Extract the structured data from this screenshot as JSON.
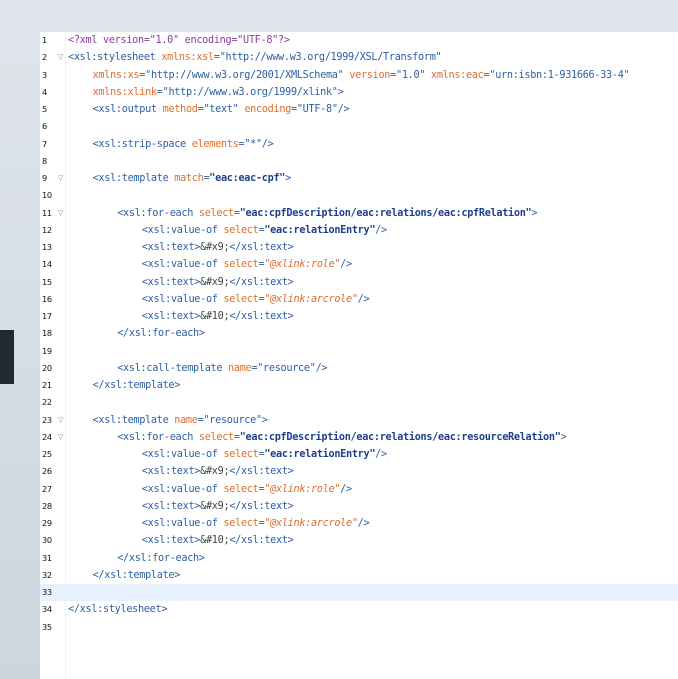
{
  "editor": {
    "lines": [
      {
        "n": "1",
        "fold": "",
        "indent": 0,
        "tokens": [
          [
            "pi",
            "<?xml version=\"1.0\" encoding=\"UTF-8\"?>"
          ]
        ]
      },
      {
        "n": "2",
        "fold": "▽",
        "indent": 0,
        "tokens": [
          [
            "tag",
            "<xsl:stylesheet "
          ],
          [
            "attr",
            "xmlns:xsl"
          ],
          [
            "tag",
            "="
          ],
          [
            "val",
            "\"http://www.w3.org/1999/XSL/Transform\""
          ]
        ]
      },
      {
        "n": "3",
        "fold": "",
        "indent": 4,
        "tokens": [
          [
            "attr",
            "xmlns:xs"
          ],
          [
            "tag",
            "="
          ],
          [
            "val",
            "\"http://www.w3.org/2001/XMLSchema\""
          ],
          [
            "txt",
            " "
          ],
          [
            "attr",
            "version"
          ],
          [
            "tag",
            "="
          ],
          [
            "val",
            "\"1.0\""
          ],
          [
            "txt",
            " "
          ],
          [
            "attr",
            "xmlns:eac"
          ],
          [
            "tag",
            "="
          ],
          [
            "val",
            "\"urn:isbn:1-931666-33-4\""
          ]
        ]
      },
      {
        "n": "4",
        "fold": "",
        "indent": 4,
        "tokens": [
          [
            "attr",
            "xmlns:xlink"
          ],
          [
            "tag",
            "="
          ],
          [
            "val",
            "\"http://www.w3.org/1999/xlink\""
          ],
          [
            "tag",
            ">"
          ]
        ]
      },
      {
        "n": "5",
        "fold": "",
        "indent": 4,
        "tokens": [
          [
            "tag",
            "<xsl:output "
          ],
          [
            "attr",
            "method"
          ],
          [
            "tag",
            "="
          ],
          [
            "val",
            "\"text\""
          ],
          [
            "txt",
            " "
          ],
          [
            "attr",
            "encoding"
          ],
          [
            "tag",
            "="
          ],
          [
            "val",
            "\"UTF-8\""
          ],
          [
            "tag",
            "/>"
          ]
        ]
      },
      {
        "n": "6",
        "fold": "",
        "indent": 0,
        "tokens": []
      },
      {
        "n": "7",
        "fold": "",
        "indent": 4,
        "tokens": [
          [
            "tag",
            "<xsl:strip-space "
          ],
          [
            "attr",
            "elements"
          ],
          [
            "tag",
            "="
          ],
          [
            "val",
            "\"*\""
          ],
          [
            "tag",
            "/>"
          ]
        ]
      },
      {
        "n": "8",
        "fold": "",
        "indent": 0,
        "tokens": []
      },
      {
        "n": "9",
        "fold": "▽",
        "indent": 4,
        "tokens": [
          [
            "tag",
            "<xsl:template "
          ],
          [
            "attr",
            "match"
          ],
          [
            "tag",
            "="
          ],
          [
            "valb",
            "\"eac:eac-cpf\""
          ],
          [
            "tag",
            ">"
          ]
        ]
      },
      {
        "n": "10",
        "fold": "",
        "indent": 0,
        "tokens": []
      },
      {
        "n": "11",
        "fold": "▽",
        "indent": 8,
        "tokens": [
          [
            "tag",
            "<xsl:for-each "
          ],
          [
            "attr",
            "select"
          ],
          [
            "tag",
            "="
          ],
          [
            "valb",
            "\"eac:cpfDescription/eac:relations/eac:cpfRelation\""
          ],
          [
            "tag",
            ">"
          ]
        ]
      },
      {
        "n": "12",
        "fold": "",
        "indent": 12,
        "tokens": [
          [
            "tag",
            "<xsl:value-of "
          ],
          [
            "attr",
            "select"
          ],
          [
            "tag",
            "="
          ],
          [
            "valb",
            "\"eac:relationEntry\""
          ],
          [
            "tag",
            "/>"
          ]
        ]
      },
      {
        "n": "13",
        "fold": "",
        "indent": 12,
        "tokens": [
          [
            "tag",
            "<xsl:text>"
          ],
          [
            "ent",
            "&#x9;"
          ],
          [
            "tag",
            "</xsl:text>"
          ]
        ]
      },
      {
        "n": "14",
        "fold": "",
        "indent": 12,
        "tokens": [
          [
            "tag",
            "<xsl:value-of "
          ],
          [
            "attr",
            "select"
          ],
          [
            "tag",
            "="
          ],
          [
            "vali",
            "\"@xlink:role\""
          ],
          [
            "tag",
            "/>"
          ]
        ]
      },
      {
        "n": "15",
        "fold": "",
        "indent": 12,
        "tokens": [
          [
            "tag",
            "<xsl:text>"
          ],
          [
            "ent",
            "&#x9;"
          ],
          [
            "tag",
            "</xsl:text>"
          ]
        ]
      },
      {
        "n": "16",
        "fold": "",
        "indent": 12,
        "tokens": [
          [
            "tag",
            "<xsl:value-of "
          ],
          [
            "attr",
            "select"
          ],
          [
            "tag",
            "="
          ],
          [
            "vali",
            "\"@xlink:arcrole\""
          ],
          [
            "tag",
            "/>"
          ]
        ]
      },
      {
        "n": "17",
        "fold": "",
        "indent": 12,
        "tokens": [
          [
            "tag",
            "<xsl:text>"
          ],
          [
            "ent",
            "&#10;"
          ],
          [
            "tag",
            "</xsl:text>"
          ]
        ]
      },
      {
        "n": "18",
        "fold": "",
        "indent": 8,
        "tokens": [
          [
            "tag",
            "</xsl:for-each>"
          ]
        ]
      },
      {
        "n": "19",
        "fold": "",
        "indent": 0,
        "tokens": []
      },
      {
        "n": "20",
        "fold": "",
        "indent": 8,
        "tokens": [
          [
            "tag",
            "<xsl:call-template "
          ],
          [
            "attr",
            "name"
          ],
          [
            "tag",
            "="
          ],
          [
            "val",
            "\"resource\""
          ],
          [
            "tag",
            "/>"
          ]
        ]
      },
      {
        "n": "21",
        "fold": "",
        "indent": 4,
        "tokens": [
          [
            "tag",
            "</xsl:template>"
          ]
        ]
      },
      {
        "n": "22",
        "fold": "",
        "indent": 0,
        "tokens": []
      },
      {
        "n": "23",
        "fold": "▽",
        "indent": 4,
        "tokens": [
          [
            "tag",
            "<xsl:template "
          ],
          [
            "attr",
            "name"
          ],
          [
            "tag",
            "="
          ],
          [
            "val",
            "\"resource\""
          ],
          [
            "tag",
            ">"
          ]
        ]
      },
      {
        "n": "24",
        "fold": "▽",
        "indent": 8,
        "tokens": [
          [
            "tag",
            "<xsl:for-each "
          ],
          [
            "attr",
            "select"
          ],
          [
            "tag",
            "="
          ],
          [
            "valb",
            "\"eac:cpfDescription/eac:relations/eac:resourceRelation\""
          ],
          [
            "tag",
            ">"
          ]
        ]
      },
      {
        "n": "25",
        "fold": "",
        "indent": 12,
        "tokens": [
          [
            "tag",
            "<xsl:value-of "
          ],
          [
            "attr",
            "select"
          ],
          [
            "tag",
            "="
          ],
          [
            "valb",
            "\"eac:relationEntry\""
          ],
          [
            "tag",
            "/>"
          ]
        ]
      },
      {
        "n": "26",
        "fold": "",
        "indent": 12,
        "tokens": [
          [
            "tag",
            "<xsl:text>"
          ],
          [
            "ent",
            "&#x9;"
          ],
          [
            "tag",
            "</xsl:text>"
          ]
        ]
      },
      {
        "n": "27",
        "fold": "",
        "indent": 12,
        "tokens": [
          [
            "tag",
            "<xsl:value-of "
          ],
          [
            "attr",
            "select"
          ],
          [
            "tag",
            "="
          ],
          [
            "vali",
            "\"@xlink:role\""
          ],
          [
            "tag",
            "/>"
          ]
        ]
      },
      {
        "n": "28",
        "fold": "",
        "indent": 12,
        "tokens": [
          [
            "tag",
            "<xsl:text>"
          ],
          [
            "ent",
            "&#x9;"
          ],
          [
            "tag",
            "</xsl:text>"
          ]
        ]
      },
      {
        "n": "29",
        "fold": "",
        "indent": 12,
        "tokens": [
          [
            "tag",
            "<xsl:value-of "
          ],
          [
            "attr",
            "select"
          ],
          [
            "tag",
            "="
          ],
          [
            "vali",
            "\"@xlink:arcrole\""
          ],
          [
            "tag",
            "/>"
          ]
        ]
      },
      {
        "n": "30",
        "fold": "",
        "indent": 12,
        "tokens": [
          [
            "tag",
            "<xsl:text>"
          ],
          [
            "ent",
            "&#10;"
          ],
          [
            "tag",
            "</xsl:text>"
          ]
        ]
      },
      {
        "n": "31",
        "fold": "",
        "indent": 8,
        "tokens": [
          [
            "tag",
            "</xsl:for-each>"
          ]
        ]
      },
      {
        "n": "32",
        "fold": "",
        "indent": 4,
        "tokens": [
          [
            "tag",
            "</xsl:template>"
          ]
        ]
      },
      {
        "n": "33",
        "fold": "",
        "indent": 0,
        "current": true,
        "tokens": []
      },
      {
        "n": "34",
        "fold": "",
        "indent": 0,
        "tokens": [
          [
            "tag",
            "</xsl:stylesheet>"
          ]
        ]
      },
      {
        "n": "35",
        "fold": "",
        "indent": 0,
        "tokens": []
      }
    ]
  }
}
